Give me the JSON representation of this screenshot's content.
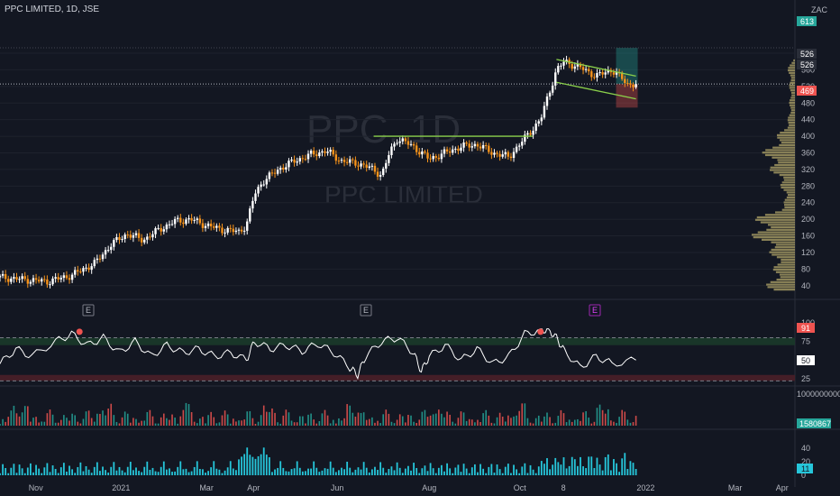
{
  "title": "PPC LIMITED, 1D, JSE",
  "currency": "ZAC",
  "watermark": {
    "symbol": "PPC, 1D",
    "name": "PPC LIMITED"
  },
  "colors": {
    "background": "#131722",
    "up": "#ffffff",
    "down": "#f7931a",
    "pattern": "#8bd14b",
    "rsi": "#ffffff",
    "volume": "#26c6da",
    "target": "#26a69a",
    "stop": "#ef5350"
  },
  "badges": {
    "e1": "E",
    "e2": "E",
    "e3": "E"
  },
  "price_tags": {
    "target": "613",
    "last_a": "526",
    "last_b": "526",
    "stop": "469"
  },
  "rsi_tags": {
    "max": "91",
    "current": "50"
  },
  "volume_tags": {
    "top": "1000000000",
    "current": "1580867",
    "sub_current": "11"
  },
  "chart_data": {
    "type": "candlestick",
    "title": "PPC LIMITED, 1D, JSE",
    "ylim": [
      20,
      650
    ],
    "y_ticks": [
      "600",
      "560",
      "520",
      "480",
      "440",
      "400",
      "360",
      "320",
      "280",
      "240",
      "200",
      "160",
      "120",
      "80",
      "40"
    ],
    "x_ticks": [
      "Nov",
      "2021",
      "Mar",
      "Apr",
      "Jun",
      "Aug",
      "Oct",
      "8",
      "2022",
      "Mar",
      "Apr"
    ],
    "price_path": [
      [
        0,
        60
      ],
      [
        0.03,
        55
      ],
      [
        0.06,
        50
      ],
      [
        0.09,
        65
      ],
      [
        0.12,
        95
      ],
      [
        0.14,
        140
      ],
      [
        0.16,
        165
      ],
      [
        0.18,
        150
      ],
      [
        0.2,
        175
      ],
      [
        0.22,
        195
      ],
      [
        0.24,
        200
      ],
      [
        0.26,
        185
      ],
      [
        0.28,
        175
      ],
      [
        0.3,
        170
      ],
      [
        0.31,
        185
      ],
      [
        0.32,
        260
      ],
      [
        0.33,
        290
      ],
      [
        0.35,
        320
      ],
      [
        0.37,
        340
      ],
      [
        0.39,
        355
      ],
      [
        0.41,
        365
      ],
      [
        0.43,
        340
      ],
      [
        0.45,
        335
      ],
      [
        0.47,
        320
      ],
      [
        0.48,
        305
      ],
      [
        0.49,
        360
      ],
      [
        0.5,
        395
      ],
      [
        0.52,
        375
      ],
      [
        0.54,
        345
      ],
      [
        0.56,
        360
      ],
      [
        0.58,
        375
      ],
      [
        0.6,
        380
      ],
      [
        0.62,
        360
      ],
      [
        0.64,
        350
      ],
      [
        0.66,
        395
      ],
      [
        0.68,
        440
      ],
      [
        0.69,
        500
      ],
      [
        0.7,
        560
      ],
      [
        0.71,
        580
      ],
      [
        0.73,
        565
      ],
      [
        0.75,
        545
      ],
      [
        0.77,
        560
      ],
      [
        0.79,
        525
      ],
      [
        0.8,
        526
      ]
    ],
    "pattern": {
      "resistance_level": 400,
      "flag_upper": [
        [
          0.7,
          585
        ],
        [
          0.8,
          545
        ]
      ],
      "flag_lower": [
        [
          0.7,
          530
        ],
        [
          0.8,
          490
        ]
      ]
    },
    "position": {
      "entry": 526,
      "target": 613,
      "stop": 469
    },
    "volume_profile": [
      {
        "price": 40,
        "value": 0.4
      },
      {
        "price": 80,
        "value": 0.3
      },
      {
        "price": 120,
        "value": 0.35
      },
      {
        "price": 160,
        "value": 0.6
      },
      {
        "price": 200,
        "value": 0.55
      },
      {
        "price": 240,
        "value": 0.15
      },
      {
        "price": 280,
        "value": 0.2
      },
      {
        "price": 320,
        "value": 0.35
      },
      {
        "price": 360,
        "value": 0.45
      },
      {
        "price": 400,
        "value": 0.25
      },
      {
        "price": 440,
        "value": 0.1
      },
      {
        "price": 480,
        "value": 0.08
      },
      {
        "price": 520,
        "value": 0.08
      },
      {
        "price": 560,
        "value": 0.1
      }
    ],
    "rsi": {
      "ylim": [
        20,
        100
      ],
      "y_ticks": [
        "100",
        "75",
        "50",
        "25"
      ],
      "levels": [
        70,
        30
      ],
      "current": 50,
      "max": 91,
      "series": [
        [
          0,
          45
        ],
        [
          0.02,
          65
        ],
        [
          0.04,
          55
        ],
        [
          0.07,
          75
        ],
        [
          0.09,
          85
        ],
        [
          0.11,
          70
        ],
        [
          0.13,
          80
        ],
        [
          0.15,
          60
        ],
        [
          0.17,
          75
        ],
        [
          0.19,
          55
        ],
        [
          0.21,
          70
        ],
        [
          0.23,
          60
        ],
        [
          0.25,
          65
        ],
        [
          0.27,
          55
        ],
        [
          0.29,
          60
        ],
        [
          0.31,
          50
        ],
        [
          0.32,
          75
        ],
        [
          0.34,
          65
        ],
        [
          0.36,
          70
        ],
        [
          0.38,
          62
        ],
        [
          0.4,
          72
        ],
        [
          0.42,
          60
        ],
        [
          0.44,
          40
        ],
        [
          0.45,
          30
        ],
        [
          0.46,
          55
        ],
        [
          0.48,
          75
        ],
        [
          0.5,
          80
        ],
        [
          0.52,
          60
        ],
        [
          0.53,
          35
        ],
        [
          0.54,
          55
        ],
        [
          0.56,
          70
        ],
        [
          0.58,
          50
        ],
        [
          0.6,
          65
        ],
        [
          0.62,
          45
        ],
        [
          0.64,
          55
        ],
        [
          0.66,
          85
        ],
        [
          0.68,
          90
        ],
        [
          0.69,
          91
        ],
        [
          0.7,
          80
        ],
        [
          0.71,
          62
        ],
        [
          0.73,
          40
        ],
        [
          0.75,
          55
        ],
        [
          0.77,
          45
        ],
        [
          0.8,
          50
        ]
      ]
    },
    "volume": {
      "ylim": [
        0,
        60
      ],
      "y_ticks": [
        "40",
        "20",
        "0"
      ],
      "current": 11
    }
  }
}
